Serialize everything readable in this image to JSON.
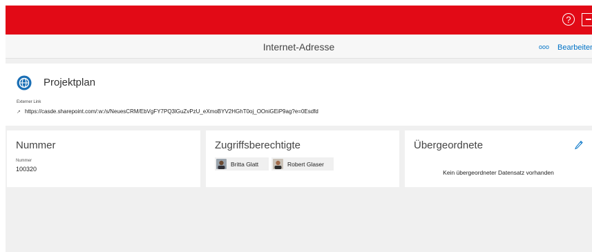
{
  "header": {
    "help_icon": "?",
    "exit_icon": "sign-out-icon"
  },
  "titlebar": {
    "title": "Internet-Adresse",
    "more_label": "ooo",
    "edit_label": "Bearbeiten"
  },
  "record": {
    "title": "Projektplan",
    "link_label": "Externer Link",
    "url": "https://casde.sharepoint.com/:w:/s/NeuesCRM/EbVgFY7PQ3lGuZvPzU_eXmoBYV2HGhT0oj_OOniGEiP9ag?e=0Esdfd",
    "icon": "globe-icon"
  },
  "cards": {
    "nummer": {
      "title": "Nummer",
      "label": "Nummer",
      "value": "100320"
    },
    "access": {
      "title": "Zugriffsberechtigte",
      "users": [
        {
          "name": "Britta Glatt"
        },
        {
          "name": "Robert Glaser"
        }
      ]
    },
    "parent": {
      "title": "Übergeordnete",
      "empty_text": "Kein übergeordneter Datensatz vorhanden",
      "edit_icon": "pencil-icon"
    }
  },
  "colors": {
    "brand": "#e20a16",
    "accent": "#0072c6",
    "background": "#f0f0f0"
  }
}
